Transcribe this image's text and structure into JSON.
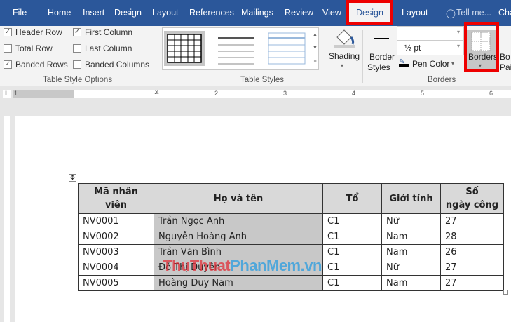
{
  "tabs": [
    "File",
    "Home",
    "Insert",
    "Design",
    "Layout",
    "References",
    "Mailings",
    "Review",
    "View",
    "Design",
    "Layout"
  ],
  "tell_me": "Tell me...",
  "share_partial": "Cha",
  "style_options": {
    "header_row": "Header Row",
    "total_row": "Total Row",
    "banded_rows": "Banded Rows",
    "first_column": "First Column",
    "last_column": "Last Column",
    "banded_columns": "Banded Columns",
    "group": "Table Style Options"
  },
  "checked": {
    "header_row": true,
    "total_row": false,
    "banded_rows": true,
    "first_column": true,
    "last_column": false,
    "banded_columns": false
  },
  "table_styles": {
    "group": "Table Styles",
    "shading": "Shading"
  },
  "borders": {
    "border_styles_1": "Border",
    "border_styles_2": "Styles",
    "weight": "½ pt",
    "pen_color": "Pen Color",
    "borders": "Borders",
    "border_painter_1": "Bo",
    "border_painter_2": "Pai",
    "group": "Borders"
  },
  "ruler": [
    "1",
    "2",
    "3",
    "4",
    "5",
    "6"
  ],
  "table": {
    "headers": [
      [
        "Mã nhân",
        "viên"
      ],
      [
        "Họ và tên"
      ],
      [
        "Tổ"
      ],
      [
        "Giới tính"
      ],
      [
        "Số",
        "ngày công"
      ]
    ],
    "rows": [
      [
        "NV0001",
        "Trần Ngọc Anh",
        "C1",
        "Nữ",
        "27"
      ],
      [
        "NV0002",
        "Nguyễn Hoàng Anh",
        "C1",
        "Nam",
        "28"
      ],
      [
        "NV0003",
        "Trần Văn Bình",
        "C1",
        "Nam",
        "26"
      ],
      [
        "NV0004",
        "Đỗ Thị Duyên",
        "C1",
        "Nữ",
        "27"
      ],
      [
        "NV0005",
        "Hoàng Duy Nam",
        "C1",
        "Nam",
        "27"
      ]
    ]
  },
  "watermark": {
    "part1": "ThuThuat",
    "part2": "PhanMem.vn",
    "color1": "#e0303a",
    "color2": "#2a9de0"
  },
  "colors": {
    "title_bar": "#2b579a",
    "highlight": "#ee0000"
  }
}
